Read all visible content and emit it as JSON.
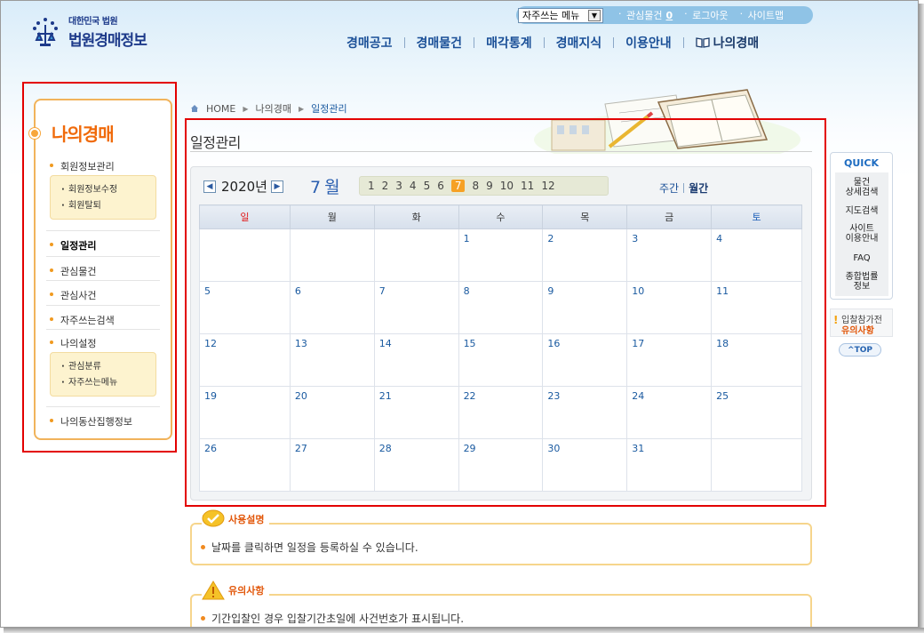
{
  "header": {
    "logo_small": "대한민국 법원",
    "logo_big": "법원경매정보",
    "util": {
      "select_value": "자주쓰는 메뉴",
      "interest_label": "관심물건",
      "interest_count": "0",
      "logout": "로그아웃",
      "sitemap": "사이트맵"
    },
    "gnb": [
      "경매공고",
      "경매물건",
      "매각통계",
      "경매지식",
      "이용안내",
      "나의경매"
    ]
  },
  "lnb": {
    "title": "나의경매",
    "member_info": "회원정보관리",
    "member_sub": [
      "회원정보수정",
      "회원탈퇴"
    ],
    "schedule": "일정관리",
    "interest_items": "관심물건",
    "interest_cases": "관심사건",
    "frequent_search": "자주쓰는검색",
    "my_settings": "나의설정",
    "settings_sub": [
      "관심분류",
      "자주쓰는메뉴"
    ],
    "movable_exec": "나의동산집행정보"
  },
  "breadcrumb": [
    "HOME",
    "나의경매",
    "일정관리"
  ],
  "page_title": "일정관리",
  "calendar": {
    "year_label": "2020년",
    "month_label": "7 월",
    "months": [
      "1",
      "2",
      "3",
      "4",
      "5",
      "6",
      "7",
      "8",
      "9",
      "10",
      "11",
      "12"
    ],
    "selected_month": "7",
    "view_week": "주간",
    "view_month": "월간",
    "weekdays": [
      "일",
      "월",
      "화",
      "수",
      "목",
      "금",
      "토"
    ],
    "weeks": [
      [
        "",
        "",
        "",
        "1",
        "2",
        "3",
        "4"
      ],
      [
        "5",
        "6",
        "7",
        "8",
        "9",
        "10",
        "11"
      ],
      [
        "12",
        "13",
        "14",
        "15",
        "16",
        "17",
        "18"
      ],
      [
        "19",
        "20",
        "21",
        "22",
        "23",
        "24",
        "25"
      ],
      [
        "26",
        "27",
        "28",
        "29",
        "30",
        "31",
        ""
      ]
    ]
  },
  "usage": {
    "title": "사용설명",
    "text": "날짜를 클릭하면 일정을 등록하실 수 있습니다."
  },
  "caution": {
    "title": "유의사항",
    "text": "기간입찰인 경우 입찰기간초일에 사건번호가 표시됩니다."
  },
  "quick": {
    "title": "QUICK",
    "items": [
      [
        "물건",
        "상세검색"
      ],
      [
        "지도검색"
      ],
      [
        "사이트",
        "이용안내"
      ],
      [
        "FAQ"
      ],
      [
        "종합법률",
        "정보"
      ]
    ],
    "bid_note_1": "입찰참가전",
    "bid_note_2": "유의사항",
    "top": "^TOP"
  },
  "colors": {
    "accent_orange": "#f06a0a",
    "link_blue": "#1a4f97",
    "selected_month": "#f6a124",
    "highlight_outline": "#e30000"
  }
}
